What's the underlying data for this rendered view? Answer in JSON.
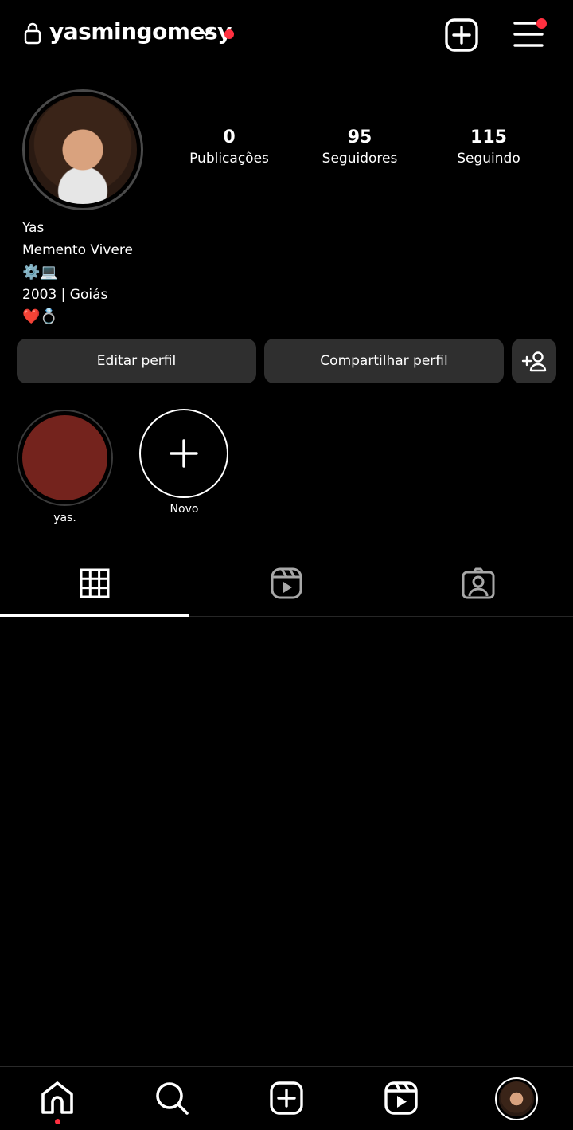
{
  "header": {
    "username": "yasmingomesy",
    "lock_icon": "lock-icon",
    "switch_icon": "chevron-down-icon",
    "new_post_icon": "plus-square-icon",
    "menu_icon": "hamburger-menu-icon",
    "notification_color": "#ff3040"
  },
  "profile": {
    "stats": [
      {
        "value": "0",
        "label": "Publicações"
      },
      {
        "value": "95",
        "label": "Seguidores"
      },
      {
        "value": "115",
        "label": "Seguindo"
      }
    ],
    "bio": {
      "name": "Yas",
      "line1": "Memento Vivere",
      "line2": "⚙️💻",
      "line3": "2003 | Goiás",
      "line4": "❤️💍"
    }
  },
  "actions": {
    "edit_label": "Editar perfil",
    "share_label": "Compartilhar perfil",
    "add_person_icon": "add-person-icon"
  },
  "highlights": [
    {
      "label": "yas.",
      "color": "#74231d"
    },
    {
      "label": "Novo",
      "icon": "plus-icon"
    }
  ],
  "tabs": [
    {
      "icon": "grid-icon",
      "active": true
    },
    {
      "icon": "reels-icon",
      "active": false
    },
    {
      "icon": "tagged-icon",
      "active": false
    }
  ],
  "bottom_nav": [
    {
      "icon": "home-icon",
      "active": true
    },
    {
      "icon": "search-icon"
    },
    {
      "icon": "create-icon"
    },
    {
      "icon": "reels-icon"
    },
    {
      "icon": "profile-avatar"
    }
  ]
}
